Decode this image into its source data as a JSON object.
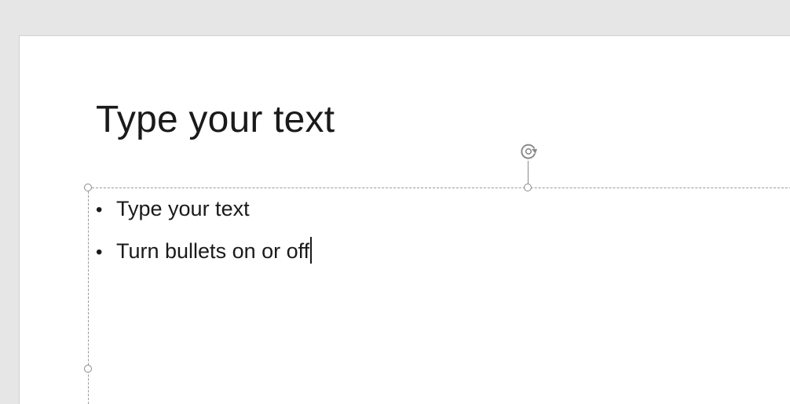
{
  "slide": {
    "title": "Type your text",
    "bullets": [
      {
        "text": "Type your text"
      },
      {
        "text": "Turn bullets on or off"
      }
    ],
    "bullet_glyph": "•"
  },
  "icons": {
    "rotate_handle": "rotate-icon"
  },
  "colors": {
    "workspace_bg": "#e6e6e6",
    "slide_bg": "#ffffff",
    "text": "#1a1a1a",
    "selection_outline": "#9a9a9a"
  }
}
